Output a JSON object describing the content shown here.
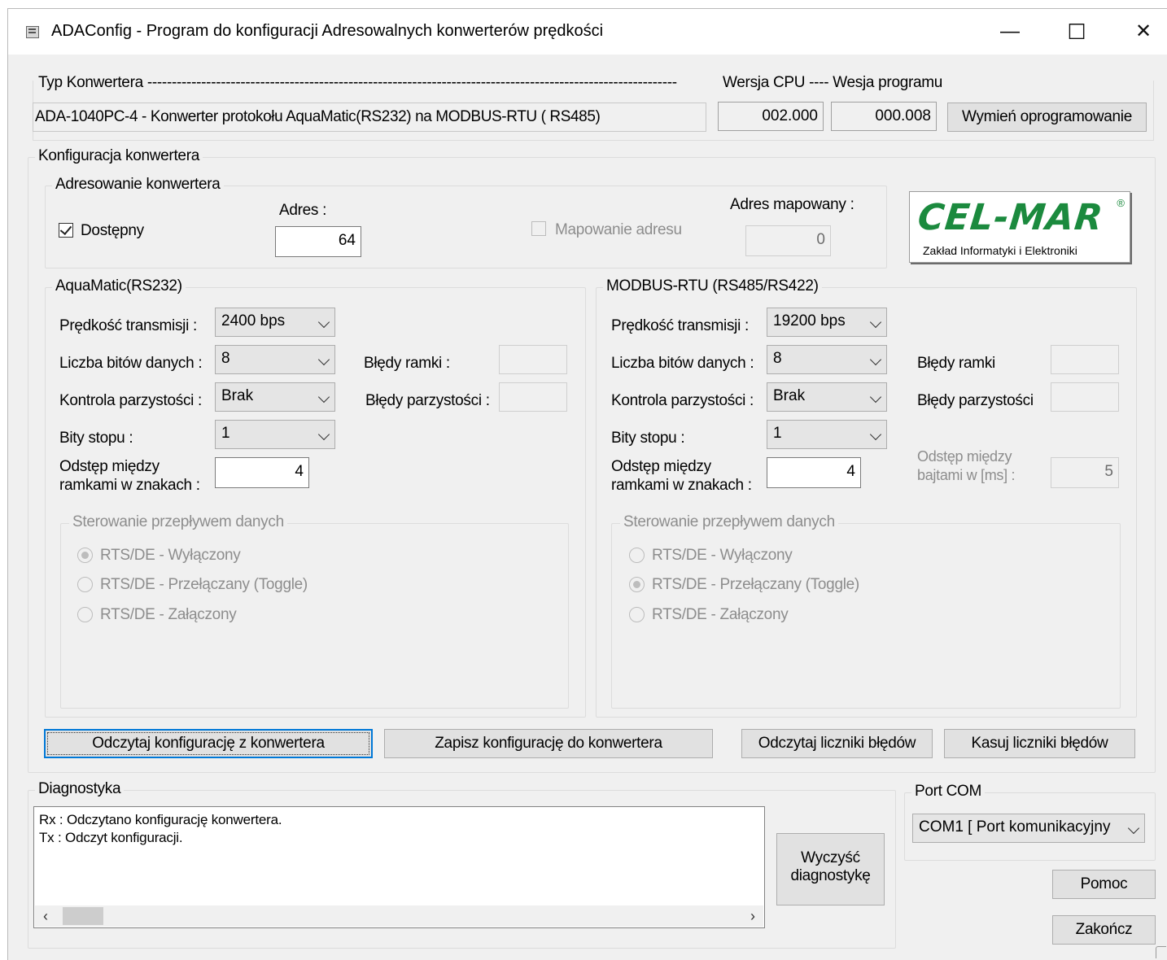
{
  "window": {
    "title": "ADAConfig - Program do konfiguracji Adresowalnych konwerterów prędkości",
    "minimize": "—",
    "maximize": "☐",
    "close": "✕"
  },
  "header": {
    "type_label": "Typ Konwertera ------------------------------------------------------------------------------------------------------------",
    "cpu_label": "Wersja CPU ---- Wesja programu",
    "type_value": "ADA-1040PC-4 - Konwerter protokołu AquaMatic(RS232) na  MODBUS-RTU ( RS485)",
    "cpu_version": "002.000",
    "program_version": "000.008",
    "update_button": "Wymień oprogramowanie"
  },
  "config": {
    "legend": "Konfiguracja konwertera",
    "addressing": {
      "legend": "Adresowanie konwertera",
      "available_label": "Dostępny",
      "available_checked": true,
      "address_label": "Adres :",
      "address_value": "64",
      "mapping_label": "Mapowanie adresu",
      "mapped_label": "Adres mapowany :",
      "mapped_value": "0"
    },
    "logo": {
      "brand": "CEL-MAR",
      "reg": "®",
      "subtitle": "Zakład Informatyki i Elektroniki",
      "color": "#1b8a3e"
    },
    "aquamatic": {
      "legend": "AquaMatic(RS232)",
      "speed_label": "Prędkość transmisji :",
      "speed_value": "2400 bps",
      "bits_label": "Liczba bitów danych :",
      "bits_value": "8",
      "parity_label": "Kontrola parzystości :",
      "parity_value": "Brak",
      "stop_label": "Bity stopu :",
      "stop_value": "1",
      "gap_label_1": "Odstęp między",
      "gap_label_2": "ramkami w znakach  :",
      "gap_value": "4",
      "frame_errors_label": "Błędy ramki :",
      "frame_errors_value": "",
      "parity_errors_label": "Błędy parzystości :",
      "parity_errors_value": "",
      "flow_legend": "Sterowanie przepływem danych",
      "flow_options": [
        "RTS/DE - Wyłączony",
        "RTS/DE - Przełączany (Toggle)",
        "RTS/DE - Załączony"
      ],
      "flow_selected": 0
    },
    "modbus": {
      "legend": "MODBUS-RTU (RS485/RS422)",
      "speed_label": "Prędkość transmisji :",
      "speed_value": "19200 bps",
      "bits_label": "Liczba bitów danych :",
      "bits_value": "8",
      "parity_label": "Kontrola parzystości :",
      "parity_value": "Brak",
      "stop_label": "Bity stopu :",
      "stop_value": "1",
      "gap_label_1": "Odstęp między",
      "gap_label_2": "ramkami w znakach :",
      "gap_value": "4",
      "frame_errors_label": "Błędy ramki",
      "frame_errors_value": "",
      "parity_errors_label": "Błędy parzystości",
      "parity_errors_value": "",
      "byte_gap_label_1": "Odstęp między",
      "byte_gap_label_2": "bajtami w [ms] :",
      "byte_gap_value": "5",
      "flow_legend": "Sterowanie przepływem danych",
      "flow_options": [
        "RTS/DE - Wyłączony",
        "RTS/DE - Przełączany (Toggle)",
        "RTS/DE - Załączony"
      ],
      "flow_selected": 1
    },
    "buttons": {
      "read_config": "Odczytaj konfigurację z konwertera",
      "write_config": "Zapisz konfigurację do konwertera",
      "read_errors": "Odczytaj liczniki błędów",
      "clear_errors": "Kasuj liczniki błędów"
    }
  },
  "diagnostics": {
    "legend": "Diagnostyka",
    "lines": [
      "Rx : Odczytano konfigurację konwertera.",
      "Tx : Odczyt konfiguracji."
    ],
    "clear_button_1": "Wyczyść",
    "clear_button_2": "diagnostykę"
  },
  "port": {
    "legend": "Port COM",
    "value": "COM1   [ Port komunikacyjny"
  },
  "help_button": "Pomoc",
  "exit_button": "Zakończ"
}
